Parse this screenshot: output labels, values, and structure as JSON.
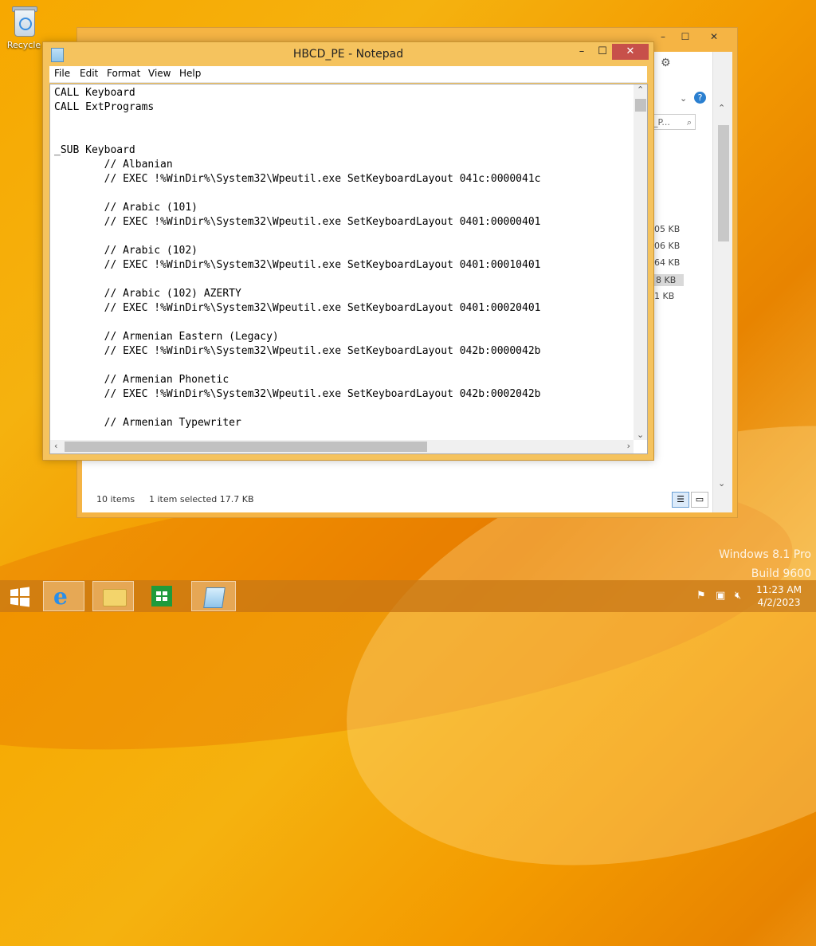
{
  "desktop": {
    "recycle_label": "Recycle",
    "watermark_line1": "Windows 8.1 Pro",
    "watermark_line2": "Build 9600"
  },
  "explorer": {
    "search_placeholder": "_P...",
    "file_sizes": [
      "05 KB",
      "06 KB",
      "64 KB",
      "8 KB",
      "1 KB"
    ],
    "status_items": "10 items",
    "status_selected": "1 item selected  17.7 KB"
  },
  "notepad": {
    "title": "HBCD_PE - Notepad",
    "menu": [
      "File",
      "Edit",
      "Format",
      "View",
      "Help"
    ],
    "lines": [
      "CALL Keyboard",
      "CALL ExtPrograms",
      "",
      "",
      "_SUB Keyboard",
      "        // Albanian",
      "        // EXEC !%WinDir%\\System32\\Wpeutil.exe SetKeyboardLayout 041c:0000041c",
      "",
      "        // Arabic (101)",
      "        // EXEC !%WinDir%\\System32\\Wpeutil.exe SetKeyboardLayout 0401:00000401",
      "",
      "        // Arabic (102)",
      "        // EXEC !%WinDir%\\System32\\Wpeutil.exe SetKeyboardLayout 0401:00010401",
      "",
      "        // Arabic (102) AZERTY",
      "        // EXEC !%WinDir%\\System32\\Wpeutil.exe SetKeyboardLayout 0401:00020401",
      "",
      "        // Armenian Eastern (Legacy)",
      "        // EXEC !%WinDir%\\System32\\Wpeutil.exe SetKeyboardLayout 042b:0000042b",
      "",
      "        // Armenian Phonetic",
      "        // EXEC !%WinDir%\\System32\\Wpeutil.exe SetKeyboardLayout 042b:0002042b",
      "",
      "        // Armenian Typewriter"
    ],
    "minimize_glyph": "–",
    "maximize_glyph": "☐",
    "close_glyph": "✕"
  },
  "taskbar": {
    "time": "11:23 AM",
    "date": "4/2/2023",
    "buttons": [
      "start-button",
      "internet-explorer",
      "file-explorer",
      "store",
      "notepad"
    ]
  }
}
